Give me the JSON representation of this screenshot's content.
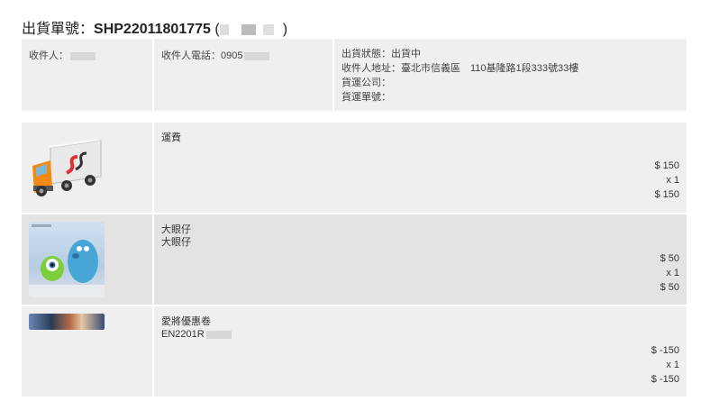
{
  "header": {
    "label": "出貨單號：",
    "order_no": "SHP22011801775",
    "paren_open": "(",
    "paren_close": ")"
  },
  "info": {
    "recipient_label": "收件人：",
    "phone_label": "收件人電話：",
    "phone_value": "0905",
    "status_line": "出貨狀態：出貨中",
    "address_line": "收件人地址：臺北市信義區　110基隆路1段333號33樓",
    "carrier_line": "貨運公司：",
    "tracking_line": "貨運單號："
  },
  "items": [
    {
      "icon": "delivery-truck-icon",
      "name_lines": [
        "運費"
      ],
      "unit_price": "$ 150",
      "qty": "x 1",
      "subtotal": "$ 150"
    },
    {
      "icon": "toy-figure-image",
      "name_lines": [
        "大眼仔",
        "大眼仔"
      ],
      "unit_price": "$ 50",
      "qty": "x 1",
      "subtotal": "$ 50"
    },
    {
      "icon": "coupon-banner-image",
      "name_lines": [
        "愛將優惠卷",
        "EN2201R"
      ],
      "unit_price": "$ -150",
      "qty": "x 1",
      "subtotal": "$ -150"
    }
  ],
  "colors": {
    "panel_bg": "#efefef",
    "alt_row_bg": "#e3e3e3"
  }
}
